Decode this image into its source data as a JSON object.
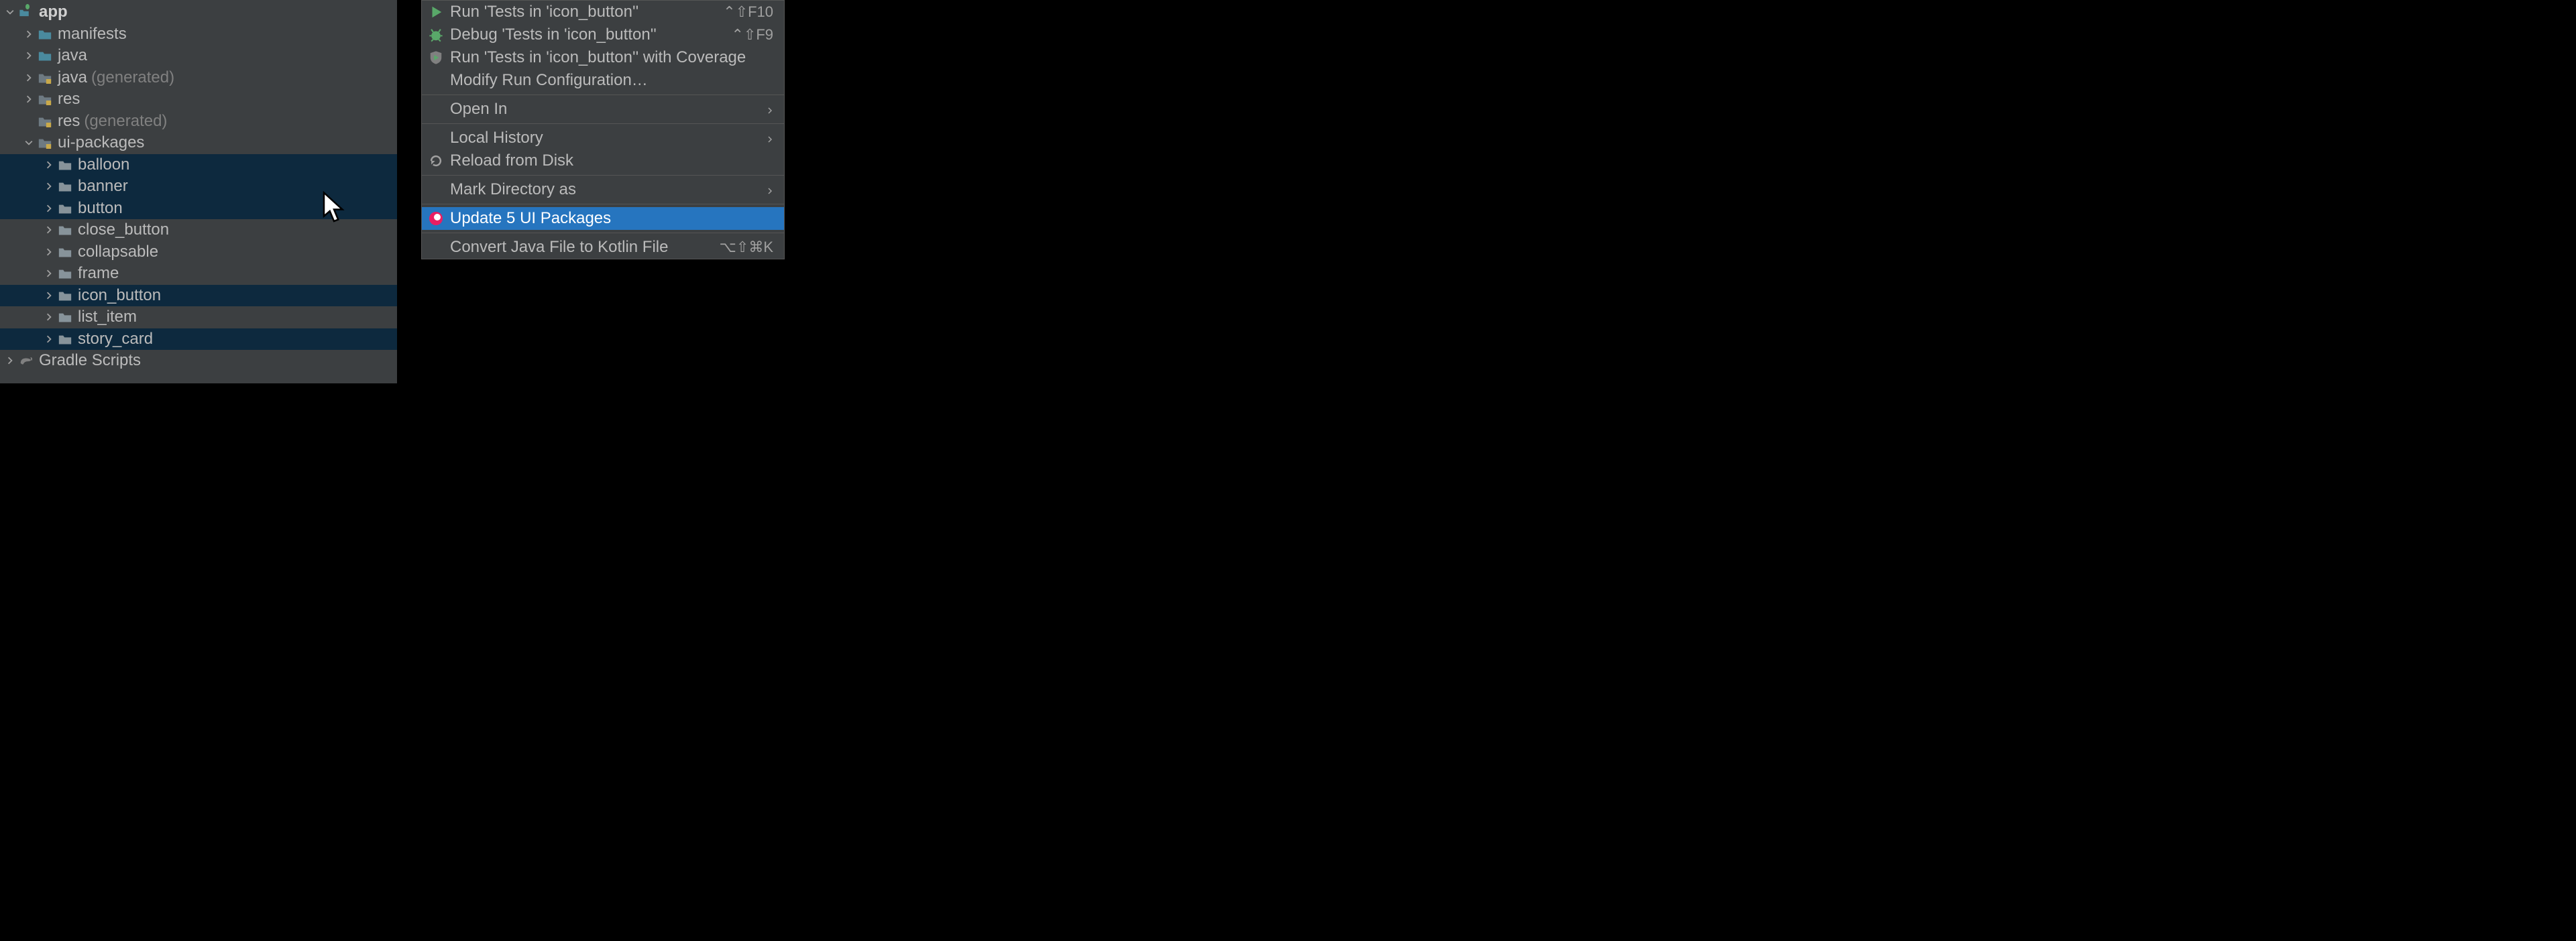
{
  "tree": {
    "app": {
      "label": "app"
    },
    "manifests": {
      "label": "manifests"
    },
    "java": {
      "label": "java"
    },
    "java_gen": {
      "label": "java",
      "suffix": "(generated)"
    },
    "res": {
      "label": "res"
    },
    "res_gen": {
      "label": "res",
      "suffix": "(generated)"
    },
    "ui_packages": {
      "label": "ui-packages"
    },
    "balloon": {
      "label": "balloon"
    },
    "banner": {
      "label": "banner"
    },
    "button": {
      "label": "button"
    },
    "close_button": {
      "label": "close_button"
    },
    "collapsable": {
      "label": "collapsable"
    },
    "frame": {
      "label": "frame"
    },
    "icon_button": {
      "label": "icon_button"
    },
    "list_item": {
      "label": "list_item"
    },
    "story_card": {
      "label": "story_card"
    },
    "gradle": {
      "label": "Gradle Scripts"
    }
  },
  "menu": {
    "run_tests": {
      "label": "Run 'Tests in 'icon_button''",
      "shortcut": "⌃⇧F10"
    },
    "debug_tests": {
      "label": "Debug 'Tests in 'icon_button''",
      "shortcut": "⌃⇧F9"
    },
    "run_coverage": {
      "label": "Run 'Tests in 'icon_button'' with Coverage"
    },
    "modify_run": {
      "label": "Modify Run Configuration…"
    },
    "open_in": {
      "label": "Open In"
    },
    "local_history": {
      "label": "Local History"
    },
    "reload_disk": {
      "label": "Reload from Disk"
    },
    "mark_dir": {
      "label": "Mark Directory as"
    },
    "update_pkg": {
      "label": "Update 5 UI Packages"
    },
    "convert_kotlin": {
      "label": "Convert Java File to Kotlin File",
      "shortcut": "⌥⇧⌘K"
    }
  }
}
